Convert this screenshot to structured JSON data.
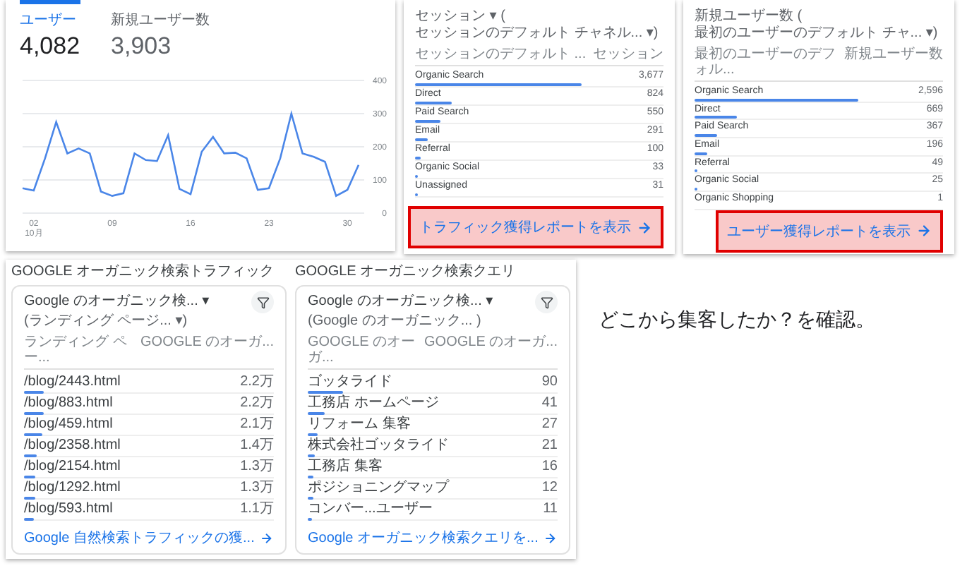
{
  "overview": {
    "tabs": [
      {
        "label": "ユーザー",
        "value": "4,082",
        "selected": true
      },
      {
        "label": "新規ユーザー数",
        "value": "3,903",
        "selected": false
      }
    ],
    "month_label": "10月",
    "chart_data": {
      "type": "line",
      "x": [
        1,
        2,
        3,
        4,
        5,
        6,
        7,
        8,
        9,
        10,
        11,
        12,
        13,
        14,
        15,
        16,
        17,
        18,
        19,
        20,
        21,
        22,
        23,
        24,
        25,
        26,
        27,
        28,
        29,
        30,
        31
      ],
      "grid": true,
      "series": [
        {
          "color": "#4a86e8",
          "values": [
            75,
            68,
            165,
            275,
            180,
            195,
            180,
            65,
            52,
            60,
            180,
            160,
            157,
            235,
            73,
            57,
            185,
            230,
            180,
            182,
            165,
            70,
            75,
            165,
            300,
            180,
            170,
            155,
            52,
            70,
            145
          ]
        }
      ],
      "xlim": [
        1,
        31
      ],
      "ylim": [
        0,
        400
      ],
      "yticks": [
        0,
        100,
        200,
        300,
        400
      ],
      "xticks": [
        {
          "value": 2,
          "label": "02"
        },
        {
          "value": 9,
          "label": "09"
        },
        {
          "value": 16,
          "label": "16"
        },
        {
          "value": 23,
          "label": "23"
        },
        {
          "value": 30,
          "label": "30"
        }
      ]
    }
  },
  "channel_cards": [
    {
      "title": "セッション ▾ (",
      "subtitle": "セッションのデフォルト チャネル... ▾)",
      "columns": [
        "セッションのデフォルト ...",
        "セッション"
      ],
      "rows": [
        {
          "name": "Organic Search",
          "value": "3,677",
          "level": 0.67
        },
        {
          "name": "Direct",
          "value": "824",
          "level": 0.15
        },
        {
          "name": "Paid Search",
          "value": "550",
          "level": 0.1
        },
        {
          "name": "Email",
          "value": "291",
          "level": 0.05
        },
        {
          "name": "Referral",
          "value": "100",
          "level": 0.02
        },
        {
          "name": "Organic Social",
          "value": "33",
          "level": 0.01
        },
        {
          "name": "Unassigned",
          "value": "31",
          "level": 0.01
        }
      ],
      "link": {
        "label": "トラフィック獲得レポートを表示",
        "highlighted": true
      }
    },
    {
      "title": "新規ユーザー数 (",
      "subtitle": "最初のユーザーのデフォルト チャ... ▾)",
      "columns": [
        "最初のユーザーのデフォル...",
        "新規ユーザー数"
      ],
      "rows": [
        {
          "name": "Organic Search",
          "value": "2,596",
          "level": 0.66
        },
        {
          "name": "Direct",
          "value": "669",
          "level": 0.17
        },
        {
          "name": "Paid Search",
          "value": "367",
          "level": 0.09
        },
        {
          "name": "Email",
          "value": "196",
          "level": 0.05
        },
        {
          "name": "Referral",
          "value": "49",
          "level": 0.01
        },
        {
          "name": "Organic Social",
          "value": "25",
          "level": 0.005
        },
        {
          "name": "Organic Shopping",
          "value": "1"
        }
      ],
      "link": {
        "label": "ユーザー獲得レポートを表示",
        "highlighted": true
      }
    }
  ],
  "search_panels": [
    {
      "section_title": "GOOGLE オーガニック検索トラフィック",
      "title": "Google のオーガニック検... ▾",
      "subtitle": "(ランディング ページ... ▾)",
      "columns": [
        "ランディング ペー...",
        "GOOGLE のオーガ..."
      ],
      "rows": [
        {
          "name": "/blog/2443.html",
          "value": "2.2万",
          "level": 0.08
        },
        {
          "name": "/blog/883.html",
          "value": "2.2万",
          "level": 0.08
        },
        {
          "name": "/blog/459.html",
          "value": "2.1万",
          "level": 0.075
        },
        {
          "name": "/blog/2358.html",
          "value": "1.4万",
          "level": 0.05
        },
        {
          "name": "/blog/2154.html",
          "value": "1.3万",
          "level": 0.045
        },
        {
          "name": "/blog/1292.html",
          "value": "1.3万",
          "level": 0.045
        },
        {
          "name": "/blog/593.html",
          "value": "1.1万",
          "level": 0.04
        }
      ],
      "link": "Google 自然検索トラフィックの獲..."
    },
    {
      "section_title": "GOOGLE オーガニック検索クエリ",
      "title": "Google のオーガニック検... ▾",
      "subtitle": "(Google のオーガニック... )",
      "columns": [
        "GOOGLE のオーガ...",
        "GOOGLE のオーガ..."
      ],
      "rows": [
        {
          "name": "ゴッタライド",
          "value": "90",
          "level": 0.14
        },
        {
          "name": "工務店 ホームページ",
          "value": "41",
          "level": 0.065
        },
        {
          "name": "リフォーム 集客",
          "value": "27",
          "level": 0.04
        },
        {
          "name": "株式会社ゴッタライド",
          "value": "21",
          "level": 0.03
        },
        {
          "name": "工務店 集客",
          "value": "16",
          "level": 0.025
        },
        {
          "name": "ポジショニングマップ",
          "value": "12",
          "level": 0.02
        },
        {
          "name": "コンバー...ユーザー",
          "value": "11",
          "level": 0.015
        }
      ],
      "link": "Google オーガニック検索クエリを..."
    }
  ],
  "note": "どこから集客したか？を確認。"
}
